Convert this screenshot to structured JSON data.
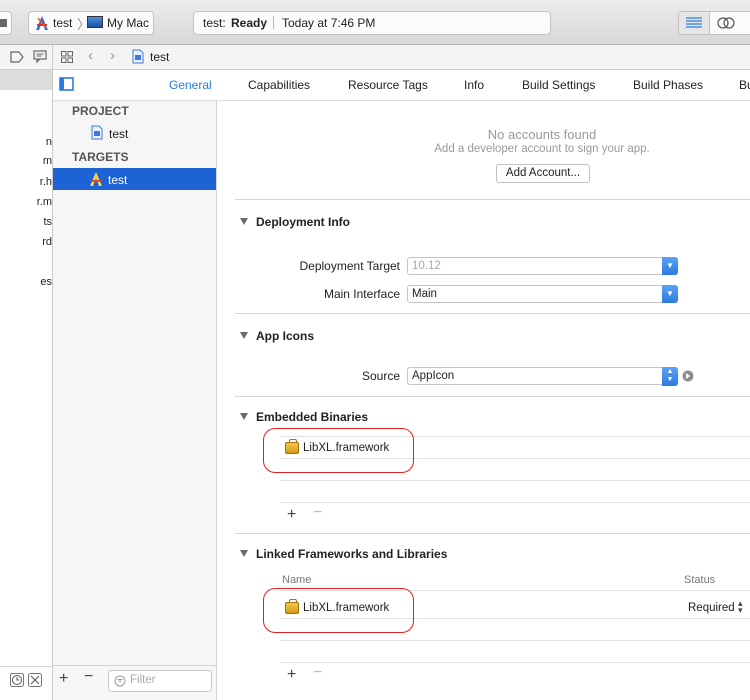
{
  "toolbar": {
    "scheme_name": "test",
    "destination": "My Mac",
    "status_project": "test:",
    "status_state": "Ready",
    "status_time": "Today at 7:46 PM"
  },
  "jumpbar": {
    "file": "test"
  },
  "navigator": {
    "fragments": [
      "n",
      "m",
      "r.h",
      "r.m",
      "ts",
      "rd",
      "es"
    ],
    "filter_placeholder": "Filter"
  },
  "tabs": [
    "General",
    "Capabilities",
    "Resource Tags",
    "Info",
    "Build Settings",
    "Build Phases",
    "Bu"
  ],
  "active_tab": "General",
  "targets_list": {
    "project_header": "PROJECT",
    "project_item": "test",
    "targets_header": "TARGETS",
    "target_item": "test"
  },
  "accounts": {
    "title": "No accounts found",
    "subtitle": "Add a developer account to sign your app.",
    "button": "Add Account..."
  },
  "deployment": {
    "title": "Deployment Info",
    "target_label": "Deployment Target",
    "target_value": "10.12",
    "interface_label": "Main Interface",
    "interface_value": "Main"
  },
  "app_icons": {
    "title": "App Icons",
    "source_label": "Source",
    "source_value": "AppIcon"
  },
  "embedded": {
    "title": "Embedded Binaries",
    "item": "LibXL.framework"
  },
  "linked": {
    "title": "Linked Frameworks and Libraries",
    "col_name": "Name",
    "col_status": "Status",
    "item": "LibXL.framework",
    "item_status": "Required"
  },
  "colors": {
    "selection": "#1d63d6",
    "accent": "#2d7ae0",
    "annotation": "#e02020"
  }
}
